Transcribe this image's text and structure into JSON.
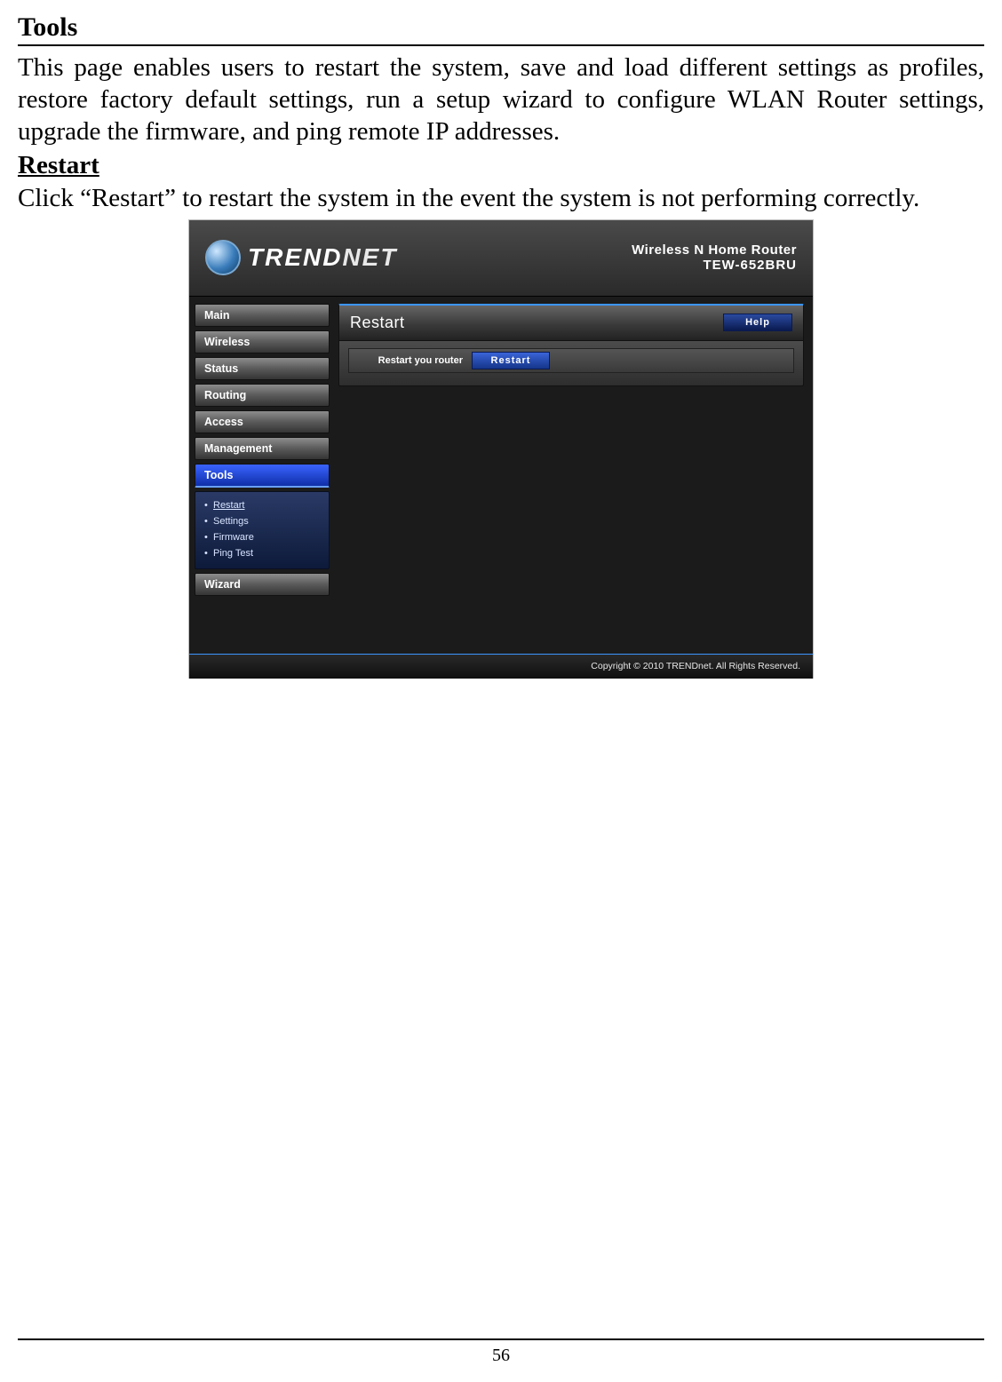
{
  "doc": {
    "section_title": "Tools",
    "intro": "This page enables users to restart the system, save and load different settings as profiles, restore factory default settings, run a setup wizard to configure WLAN Router settings, upgrade the firmware, and ping remote IP addresses.",
    "subhead": "Restart",
    "restart_text": "Click “Restart” to restart the system in the event the system is not performing correctly.",
    "page_number": "56"
  },
  "router": {
    "brand_strong": "TREND",
    "brand_light": "NET",
    "header_line1": "Wireless N Home Router",
    "header_line2": "TEW-652BRU",
    "nav": {
      "main": "Main",
      "wireless": "Wireless",
      "status": "Status",
      "routing": "Routing",
      "access": "Access",
      "management": "Management",
      "tools": "Tools",
      "wizard": "Wizard"
    },
    "subnav": {
      "restart": "Restart",
      "settings": "Settings",
      "firmware": "Firmware",
      "pingtest": "Ping Test"
    },
    "panel": {
      "title": "Restart",
      "help": "Help",
      "row_label": "Restart you router",
      "restart_btn": "Restart"
    },
    "footer": "Copyright © 2010 TRENDnet. All Rights Reserved."
  }
}
